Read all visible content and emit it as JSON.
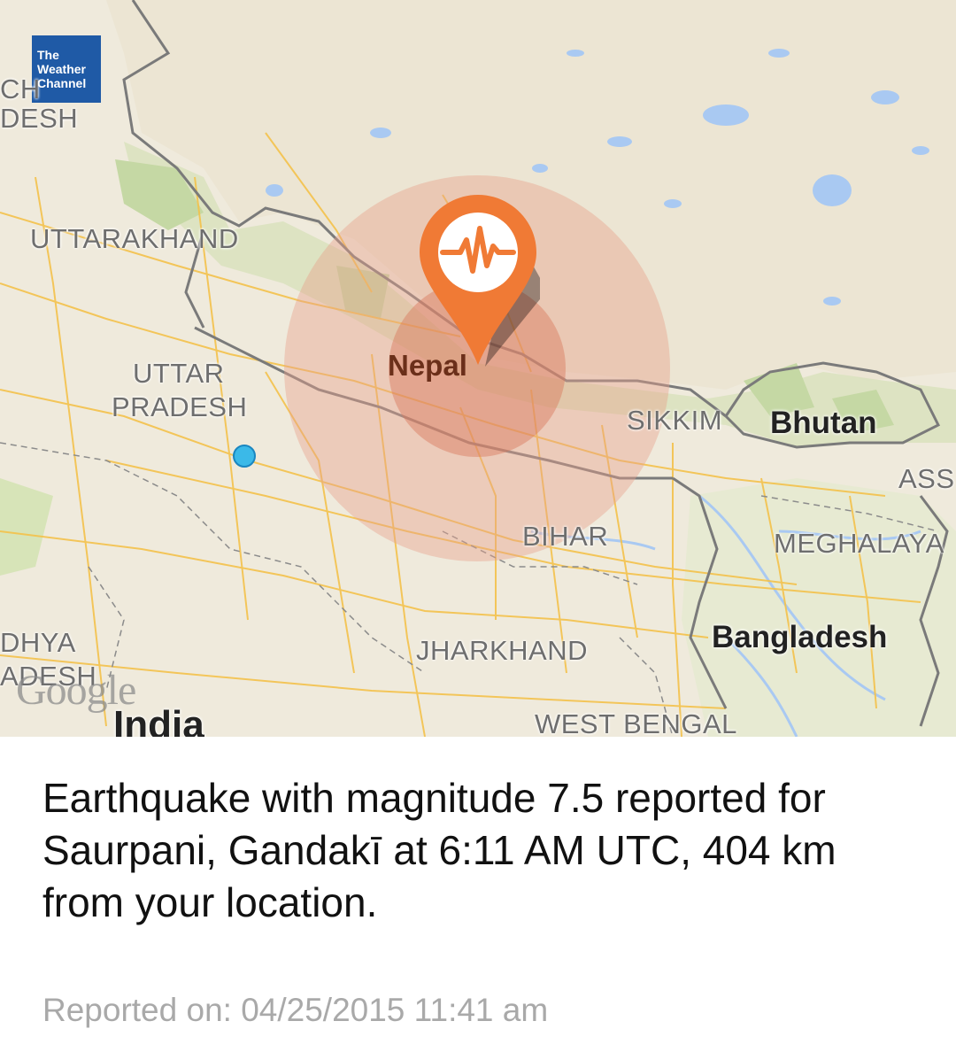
{
  "brand": {
    "logo_lines": [
      "The",
      "Weather",
      "Channel"
    ]
  },
  "map": {
    "states": {
      "uttarakhand": "UTTARAKHAND",
      "uttar_line1": "UTTAR",
      "uttar_line2": "PRADESH",
      "bihar": "BIHAR",
      "sikkim": "SIKKIM",
      "meghalaya": "MEGHALAYA",
      "jharkhand": "JHARKHAND",
      "west_bengal": "WEST BENGAL",
      "assam_partial": "ASS",
      "himachal_partial_line1": "CH",
      "himachal_partial_line2": "DESH",
      "madhya_partial_line1": "DHYA",
      "madhya_partial_line2": "ADESH"
    },
    "countries": {
      "nepal": "Nepal",
      "bhutan": "Bhutan",
      "bangladesh": "Bangladesh",
      "india": "India"
    },
    "attribution": "Google",
    "marker_icon": "seismograph-icon",
    "colors": {
      "marker": "#f07a35",
      "impact_zone": "#e8a08a",
      "location_dot": "#3bb9e8",
      "water": "#a9c9f2",
      "roads": "#f4c24b"
    }
  },
  "alert": {
    "message": "Earthquake with magnitude 7.5 reported for Saurpani, Gandakī at 6:11 AM UTC, 404 km from your location.",
    "reported_on": "Reported on: 04/25/2015 11:41 am"
  }
}
